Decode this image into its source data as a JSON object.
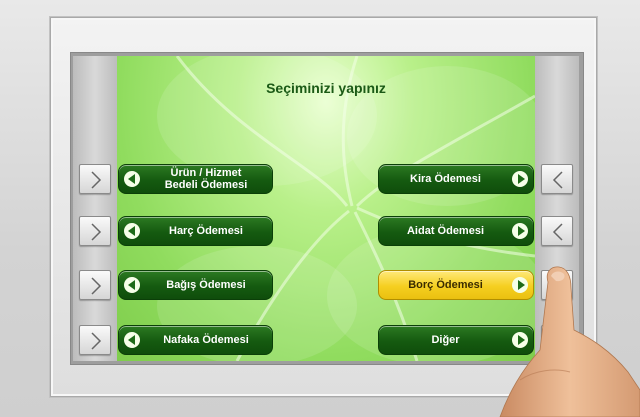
{
  "screen": {
    "title": "Seçiminizi yapınız"
  },
  "options_left": [
    {
      "label": "Ürün / Hizmet\nBedeli Ödemesi"
    },
    {
      "label": "Harç Ödemesi"
    },
    {
      "label": "Bağış Ödemesi"
    },
    {
      "label": "Nafaka Ödemesi"
    }
  ],
  "options_right": [
    {
      "label": "Kira Ödemesi"
    },
    {
      "label": "Aidat Ödemesi"
    },
    {
      "label": "Borç Ödemesi",
      "selected": true
    },
    {
      "label": "Diğer"
    }
  ],
  "colors": {
    "button_green": "#155a10",
    "button_selected_yellow": "#f5cf20",
    "screen_green": "#90dc5e",
    "title_green": "#1b5a16"
  },
  "icons": {
    "left_option_arrow": "circle-arrow-left-icon",
    "right_option_arrow": "circle-arrow-right-icon",
    "left_key_chevron": "chevron-right-icon",
    "right_key_chevron": "chevron-left-icon"
  }
}
